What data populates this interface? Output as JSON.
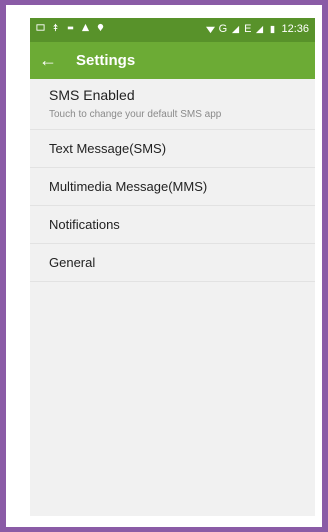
{
  "status_bar": {
    "time": "12:36",
    "network_label": "G",
    "network_label2": "E"
  },
  "toolbar": {
    "title": "Settings"
  },
  "settings": [
    {
      "title": "SMS Enabled",
      "subtitle": "Touch to change your default SMS app"
    },
    {
      "title": "Text Message(SMS)"
    },
    {
      "title": "Multimedia Message(MMS)"
    },
    {
      "title": "Notifications"
    },
    {
      "title": "General"
    }
  ],
  "colors": {
    "status_bar": "#58922a",
    "toolbar": "#6cab35",
    "border": "#8a5ba6"
  }
}
